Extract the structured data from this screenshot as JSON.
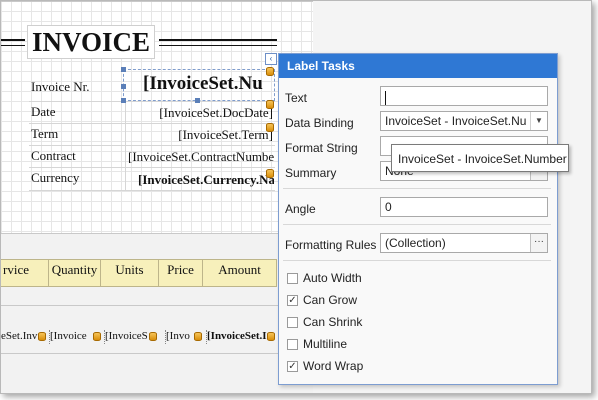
{
  "report": {
    "title": "INVOICE",
    "labels": [
      "Invoice Nr.",
      "Date",
      "Term",
      "Contract",
      "Currency"
    ],
    "fields": {
      "invoice_number": "[InvoiceSet.Nu",
      "doc_date": "[InvoiceSet.DocDate]",
      "term": "[InvoiceSet.Term]",
      "contract": "[InvoiceSet.ContractNumbe",
      "currency": "[InvoiceSet.Currency.Na"
    },
    "table_headers": [
      "rvice",
      "Quantity",
      "Units",
      "Price",
      "Amount"
    ],
    "detail_cells": [
      "eSet.Inv",
      "[Invoice",
      "[InvoiceS",
      "[Invo",
      "[InvoiceSet.I"
    ]
  },
  "panel": {
    "title": "Label Tasks",
    "text_label": "Text",
    "text_value": "",
    "data_binding_label": "Data Binding",
    "data_binding_value": "InvoiceSet - InvoiceSet.Nu",
    "format_string_label": "Format String",
    "format_string_value": "",
    "summary_label": "Summary",
    "summary_value": "None",
    "angle_label": "Angle",
    "angle_value": "0",
    "formatting_rules_label": "Formatting Rules",
    "formatting_rules_value": "(Collection)",
    "ellipsis": "···",
    "checkboxes": [
      {
        "label": "Auto Width",
        "checked": false
      },
      {
        "label": "Can Grow",
        "checked": true
      },
      {
        "label": "Can Shrink",
        "checked": false
      },
      {
        "label": "Multiline",
        "checked": false
      },
      {
        "label": "Word Wrap",
        "checked": true
      }
    ]
  },
  "tooltip": "InvoiceSet - InvoiceSet.Number",
  "colors": {
    "panel_header": "#2f78d4",
    "table_header": "#f7f0bb",
    "binding_icon": "#f2a81c"
  },
  "icons": {
    "smart_tag": "chevron-left-icon",
    "binding": "database-cylinder-icon",
    "dropdown": "chevron-down-icon",
    "checkmark": "checkmark-icon"
  }
}
